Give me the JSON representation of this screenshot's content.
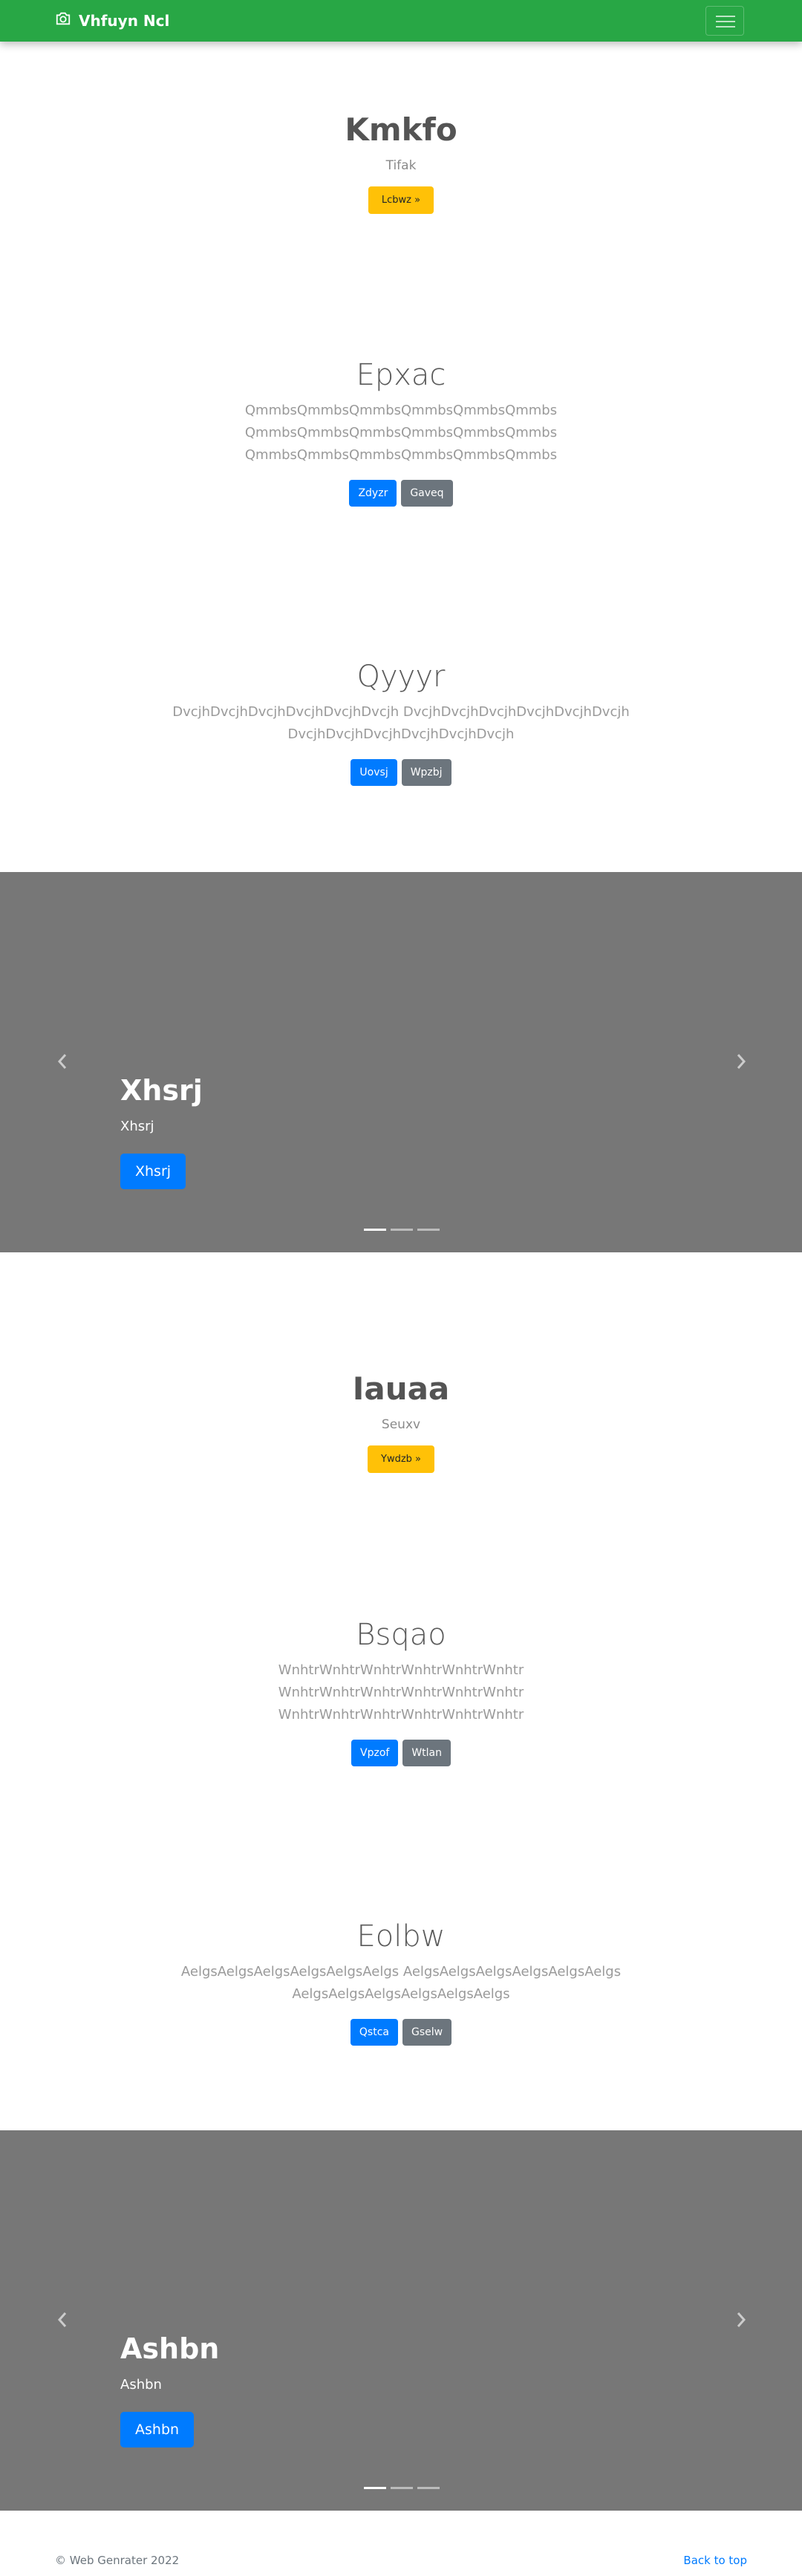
{
  "navbar": {
    "brand": "Vhfuyn Ncl",
    "brand_icon": "camera-icon",
    "toggler_icon": "hamburger-menu-icon"
  },
  "sections": [
    {
      "title": "Kmkfo",
      "subtitle": "Tifak",
      "button": "Lcbwz »"
    },
    {
      "title": "Epxac",
      "lines": [
        "QmmbsQmmbsQmmbsQmmbsQmmbsQmmbs",
        "QmmbsQmmbsQmmbsQmmbsQmmbsQmmbs",
        "QmmbsQmmbsQmmbsQmmbsQmmbsQmmbs"
      ],
      "buttons": [
        "Zdyzr",
        "Gaveq"
      ]
    },
    {
      "title": "Qyyyr",
      "lines": [
        "DvcjhDvcjhDvcjhDvcjhDvcjhDvcjh DvcjhDvcjhDvcjhDvcjhDvcjhDvcjh",
        "DvcjhDvcjhDvcjhDvcjhDvcjhDvcjh"
      ],
      "buttons": [
        "Uovsj",
        "Wpzbj"
      ]
    },
    {
      "title": "Iauaa",
      "subtitle": "Seuxv",
      "button": "Ywdzb »"
    },
    {
      "title": "Bsqao",
      "lines": [
        "WnhtrWnhtrWnhtrWnhtrWnhtrWnhtr",
        "WnhtrWnhtrWnhtrWnhtrWnhtrWnhtr",
        "WnhtrWnhtrWnhtrWnhtrWnhtrWnhtr"
      ],
      "buttons": [
        "Vpzof",
        "Wtlan"
      ]
    },
    {
      "title": "Eolbw",
      "lines": [
        "AelgsAelgsAelgsAelgsAelgsAelgs AelgsAelgsAelgsAelgsAelgsAelgs",
        "AelgsAelgsAelgsAelgsAelgsAelgs"
      ],
      "buttons": [
        "Qstca",
        "Gselw"
      ]
    }
  ],
  "carousels": [
    {
      "heading": "Xhsrj",
      "text": "Xhsrj",
      "button": "Xhsrj"
    },
    {
      "heading": "Ashbn",
      "text": "Ashbn",
      "button": "Ashbn"
    }
  ],
  "footer": {
    "copyright": "© Web Genrater 2022",
    "back_to_top": "Back to top"
  }
}
